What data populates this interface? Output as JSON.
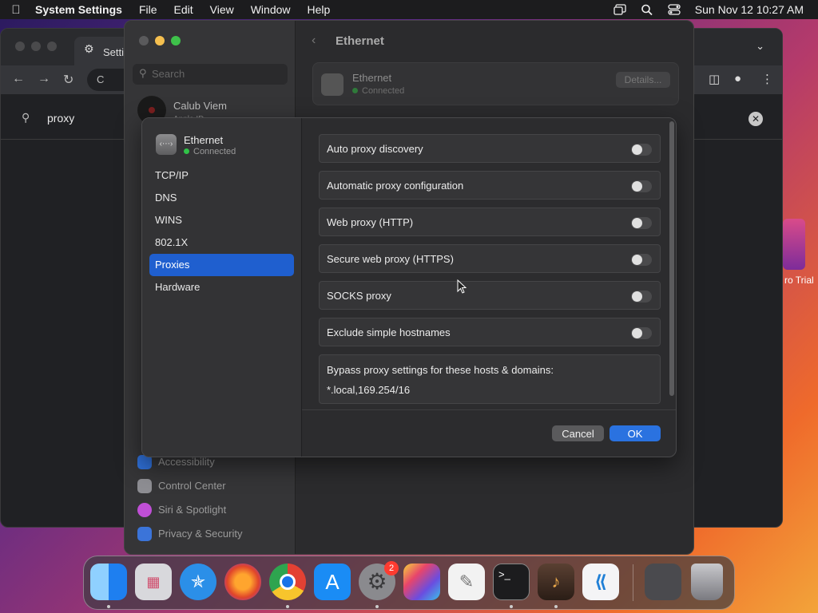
{
  "menubar": {
    "app_name": "System Settings",
    "items": [
      "File",
      "Edit",
      "View",
      "Window",
      "Help"
    ],
    "clock": "Sun Nov 12  10:27 AM"
  },
  "chrome": {
    "tab_title": "Setti",
    "omnibox_text": "C",
    "search_query": "proxy"
  },
  "desktop": {
    "icon_label": "ro Trial"
  },
  "settings": {
    "search_placeholder": "Search",
    "user_name": "Calub Viem",
    "user_sub": "Apple ID",
    "title": "Ethernet",
    "ethernet_card": {
      "name": "Ethernet",
      "status": "Connected",
      "details_label": "Details..."
    },
    "sidebar_rows": [
      {
        "label": "Accessibility",
        "color": "#2f6fd6"
      },
      {
        "label": "Control Center",
        "color": "#8e8e93"
      },
      {
        "label": "Siri & Spotlight",
        "color": "#c04fd6"
      },
      {
        "label": "Privacy & Security",
        "color": "#3b74d9"
      }
    ]
  },
  "dialog": {
    "interface": {
      "name": "Ethernet",
      "status": "Connected"
    },
    "nav": [
      "TCP/IP",
      "DNS",
      "WINS",
      "802.1X",
      "Proxies",
      "Hardware"
    ],
    "active_nav": "Proxies",
    "options": [
      {
        "label": "Auto proxy discovery",
        "enabled": false
      },
      {
        "label": "Automatic proxy configuration",
        "enabled": false
      },
      {
        "label": "Web proxy (HTTP)",
        "enabled": false
      },
      {
        "label": "Secure web proxy (HTTPS)",
        "enabled": false
      },
      {
        "label": "SOCKS proxy",
        "enabled": false
      },
      {
        "label": "Exclude simple hostnames",
        "enabled": false
      }
    ],
    "bypass": {
      "label": "Bypass proxy settings for these hosts & domains:",
      "value": "*.local,169.254/16"
    },
    "cancel_label": "Cancel",
    "ok_label": "OK"
  },
  "dock": {
    "items": [
      {
        "name": "finder-icon",
        "color": "#2c8cf0"
      },
      {
        "name": "launchpad-icon",
        "color": "#d8d8dc"
      },
      {
        "name": "safari-icon",
        "color": "#2b8fe8"
      },
      {
        "name": "firefox-icon",
        "color": "#7b3de0"
      },
      {
        "name": "chrome-icon",
        "color": "#e8e8e8"
      },
      {
        "name": "app-store-icon",
        "color": "#1a8cf5"
      },
      {
        "name": "system-settings-icon",
        "color": "#8a8a8e"
      },
      {
        "name": "final-cut-icon",
        "color": "#2a2a2c"
      },
      {
        "name": "textedit-icon",
        "color": "#f2f2f2"
      },
      {
        "name": "terminal-icon",
        "color": "#1c1c1e"
      },
      {
        "name": "garageband-icon",
        "color": "#3a2a22"
      },
      {
        "name": "vscode-icon",
        "color": "#f4f4f6"
      },
      {
        "name": "screenshot-stack-icon",
        "color": "#4a4a4e"
      },
      {
        "name": "trash-icon",
        "color": "#9a9aa0"
      }
    ],
    "system_settings_badge": "2"
  }
}
